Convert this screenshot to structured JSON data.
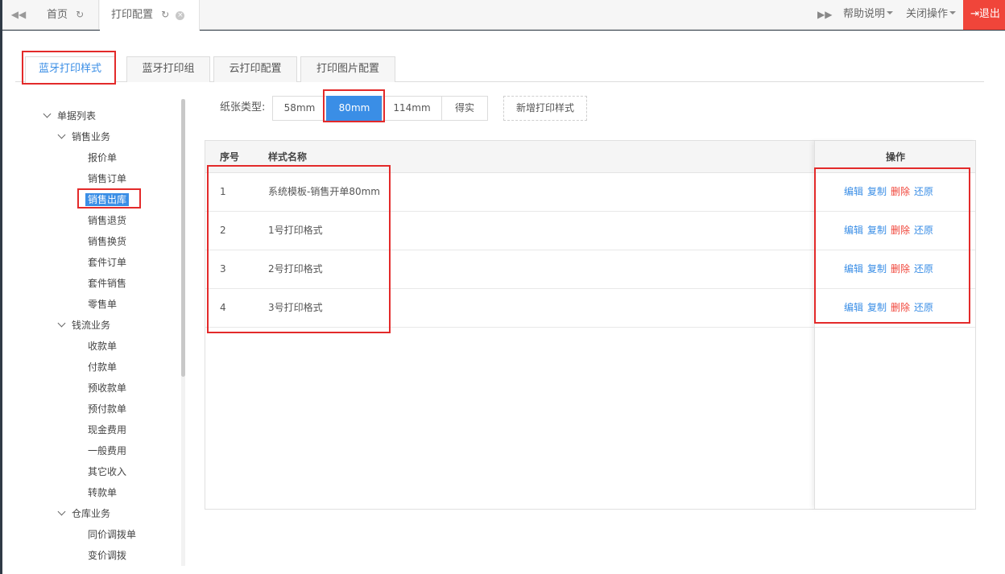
{
  "topbar": {
    "tabs": [
      {
        "label": "首页"
      },
      {
        "label": "打印配置"
      }
    ],
    "help_label": "帮助说明",
    "close_ops_label": "关闭操作",
    "logout_label": "退出"
  },
  "config_tabs": [
    "蓝牙打印样式",
    "蓝牙打印组",
    "云打印配置",
    "打印图片配置"
  ],
  "tree": {
    "root": "单据列表",
    "groups": [
      {
        "label": "销售业务",
        "items": [
          "报价单",
          "销售订单",
          "销售出库",
          "销售退货",
          "销售换货",
          "套件订单",
          "套件销售",
          "零售单"
        ]
      },
      {
        "label": "钱流业务",
        "items": [
          "收款单",
          "付款单",
          "预收款单",
          "预付款单",
          "现金费用",
          "一般费用",
          "其它收入",
          "转款单"
        ]
      },
      {
        "label": "仓库业务",
        "items": [
          "同价调拨单",
          "变价调拨"
        ]
      }
    ],
    "selected": "销售出库"
  },
  "paper": {
    "label": "纸张类型:",
    "options": [
      "58mm",
      "80mm",
      "114mm",
      "得实"
    ],
    "selected": "80mm",
    "add_label": "新增打印样式"
  },
  "table": {
    "headers": {
      "seq": "序号",
      "name": "样式名称",
      "ops": "操作"
    },
    "rows": [
      {
        "seq": "1",
        "name": "系统模板-销售开单80mm"
      },
      {
        "seq": "2",
        "name": "1号打印格式"
      },
      {
        "seq": "3",
        "name": "2号打印格式"
      },
      {
        "seq": "4",
        "name": "3号打印格式"
      }
    ],
    "actions": [
      "编辑",
      "复制",
      "删除",
      "还原"
    ]
  },
  "colors": {
    "accent": "#3a8ee6",
    "danger": "#f0453a",
    "highlight_box": "#e32a2a"
  }
}
